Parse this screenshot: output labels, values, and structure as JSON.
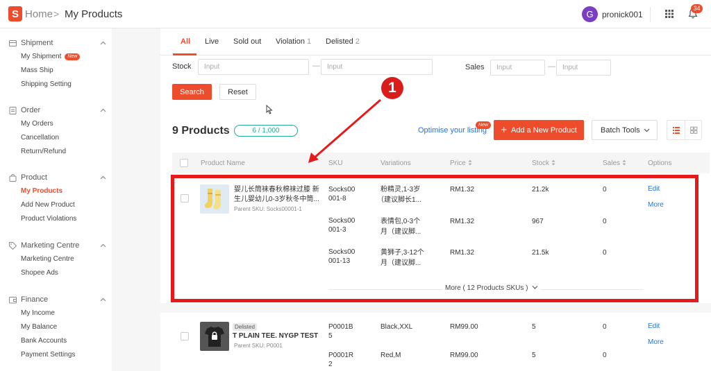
{
  "header": {
    "logo_letter": "S",
    "home": "Home",
    "separator": ">",
    "current": "My Products",
    "avatar_letter": "G",
    "username": "pronick001",
    "notification_count": "34"
  },
  "sidebar": {
    "sections": [
      {
        "title": "Shipment",
        "icon": "truck-icon",
        "items": [
          {
            "label": "My Shipment",
            "badge": "New"
          },
          {
            "label": "Mass Ship"
          },
          {
            "label": "Shipping Setting"
          }
        ]
      },
      {
        "title": "Order",
        "icon": "clipboard-icon",
        "items": [
          {
            "label": "My Orders"
          },
          {
            "label": "Cancellation"
          },
          {
            "label": "Return/Refund"
          }
        ]
      },
      {
        "title": "Product",
        "icon": "bag-icon",
        "items": [
          {
            "label": "My Products",
            "active": true
          },
          {
            "label": "Add New Product"
          },
          {
            "label": "Product Violations"
          }
        ]
      },
      {
        "title": "Marketing Centre",
        "icon": "tag-icon",
        "items": [
          {
            "label": "Marketing Centre"
          },
          {
            "label": "Shopee Ads"
          }
        ]
      },
      {
        "title": "Finance",
        "icon": "wallet-icon",
        "items": [
          {
            "label": "My Income"
          },
          {
            "label": "My Balance"
          },
          {
            "label": "Bank Accounts"
          },
          {
            "label": "Payment Settings"
          }
        ]
      }
    ]
  },
  "tabs": [
    {
      "label": "All",
      "count": "",
      "active": true
    },
    {
      "label": "Live",
      "count": ""
    },
    {
      "label": "Sold out",
      "count": ""
    },
    {
      "label": "Violation",
      "count": "1"
    },
    {
      "label": "Delisted",
      "count": "2"
    }
  ],
  "filters": {
    "stock_label": "Stock",
    "sales_label": "Sales",
    "placeholder": "Input",
    "dash": "—",
    "search": "Search",
    "reset": "Reset"
  },
  "toolbar": {
    "count_title": "9 Products",
    "quota": "6 / 1,000",
    "optimise": "Optimise your listing",
    "new_badge": "New",
    "add_product": "Add a New Product",
    "batch_tools": "Batch Tools"
  },
  "table": {
    "columns": [
      "Product Name",
      "SKU",
      "Variations",
      "Price",
      "Stock",
      "Sales",
      "Options"
    ],
    "products": [
      {
        "name_line1": "婴儿长筒袜春秋棉袜过膝 新",
        "name_line2": "生儿婴幼儿0-3岁秋冬中筒...",
        "parent_sku": "Parent SKU: Socks00001-1",
        "variants": [
          {
            "sku1": "Socks00",
            "sku2": "001-8",
            "var1": "粉精灵,1-3岁",
            "var2": "（建议脚长1...",
            "price": "RM1.32",
            "stock": "21.2k",
            "sales": "0"
          },
          {
            "sku1": "Socks00",
            "sku2": "001-3",
            "var1": "表情包,0-3个",
            "var2": "月（建议脚...",
            "price": "RM1.32",
            "stock": "967",
            "sales": "0"
          },
          {
            "sku1": "Socks00",
            "sku2": "001-13",
            "var1": "黄狮子,3-12个",
            "var2": "月（建议脚...",
            "price": "RM1.32",
            "stock": "21.5k",
            "sales": "0"
          }
        ],
        "more_skus": "More ( 12 Products SKUs )",
        "edit": "Edit",
        "more": "More"
      },
      {
        "tag": "Delisted",
        "name_line1": "T PLAIN TEE. NYGP TEST",
        "parent_sku": "Parent SKU: P0001",
        "variants": [
          {
            "sku1": "P0001B",
            "sku2": "5",
            "var1": "Black,XXL",
            "price": "RM99.00",
            "stock": "5",
            "sales": "0"
          },
          {
            "sku1": "P0001R",
            "sku2": "2",
            "var1": "Red,M",
            "price": "RM99.00",
            "stock": "5",
            "sales": "0"
          }
        ],
        "edit": "Edit",
        "more": "More"
      }
    ]
  },
  "annotation": {
    "number": "1",
    "color": "#e51a1a"
  },
  "colors": {
    "brand": "#ee4d2d",
    "link": "#2673dd",
    "quota": "#26aa99"
  }
}
